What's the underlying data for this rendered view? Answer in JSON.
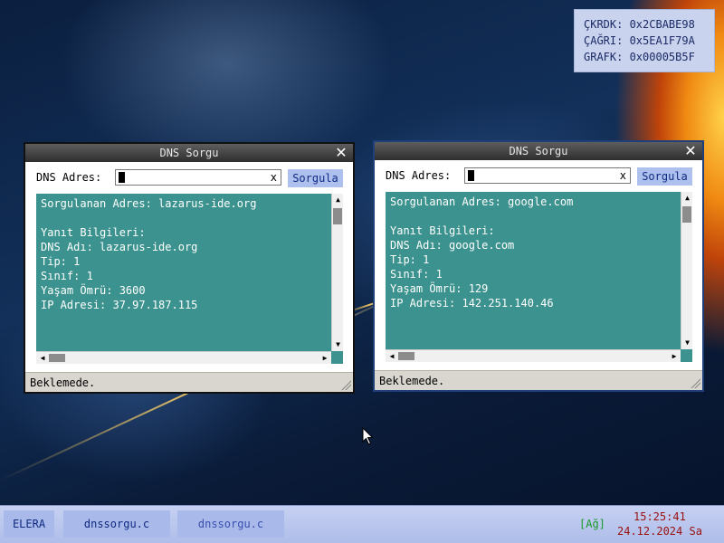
{
  "sysinfo": {
    "lines": [
      "ÇKRDK: 0x2CBABE98",
      "ÇAĞRI: 0x5EA1F79A",
      "GRAFK: 0x00005B5F"
    ]
  },
  "windows": [
    {
      "title": "DNS Sorgu",
      "address_label": "DNS Adres:",
      "address_value": "",
      "clear_label": "x",
      "query_button": "Sorgula",
      "result_lines": [
        "Sorgulanan Adres: lazarus-ide.org",
        "",
        "Yanıt Bilgileri:",
        "DNS Adı: lazarus-ide.org",
        "Tip: 1",
        "Sınıf: 1",
        "Yaşam Ömrü: 3600",
        "IP Adresi: 37.97.187.115"
      ],
      "status": "Beklemede."
    },
    {
      "title": "DNS Sorgu",
      "address_label": "DNS Adres:",
      "address_value": "",
      "clear_label": "x",
      "query_button": "Sorgula",
      "result_lines": [
        "Sorgulanan Adres: google.com",
        "",
        "Yanıt Bilgileri:",
        "DNS Adı: google.com",
        "Tip: 1",
        "Sınıf: 1",
        "Yaşam Ömrü: 129",
        "IP Adresi: 142.251.140.46"
      ],
      "status": "Beklemede."
    }
  ],
  "taskbar": {
    "start_label": "ELERA",
    "tasks": [
      "dnssorgu.c",
      "dnssorgu.c"
    ],
    "network_label": "[Ağ]",
    "time": "15:25:41",
    "date": "24.12.2024 Sa"
  },
  "icons": {
    "close": "close-icon",
    "scroll_up": "arrow-up-icon",
    "scroll_down": "arrow-down-icon",
    "scroll_left": "arrow-left-icon",
    "scroll_right": "arrow-right-icon",
    "cursor": "mouse-pointer-icon"
  },
  "colors": {
    "result_bg": "#3b928e",
    "button_bg": "#aec0ee",
    "taskbar_bg": "#aebde9",
    "clock_text": "#9a1010",
    "network_text": "#1a9a2a"
  }
}
